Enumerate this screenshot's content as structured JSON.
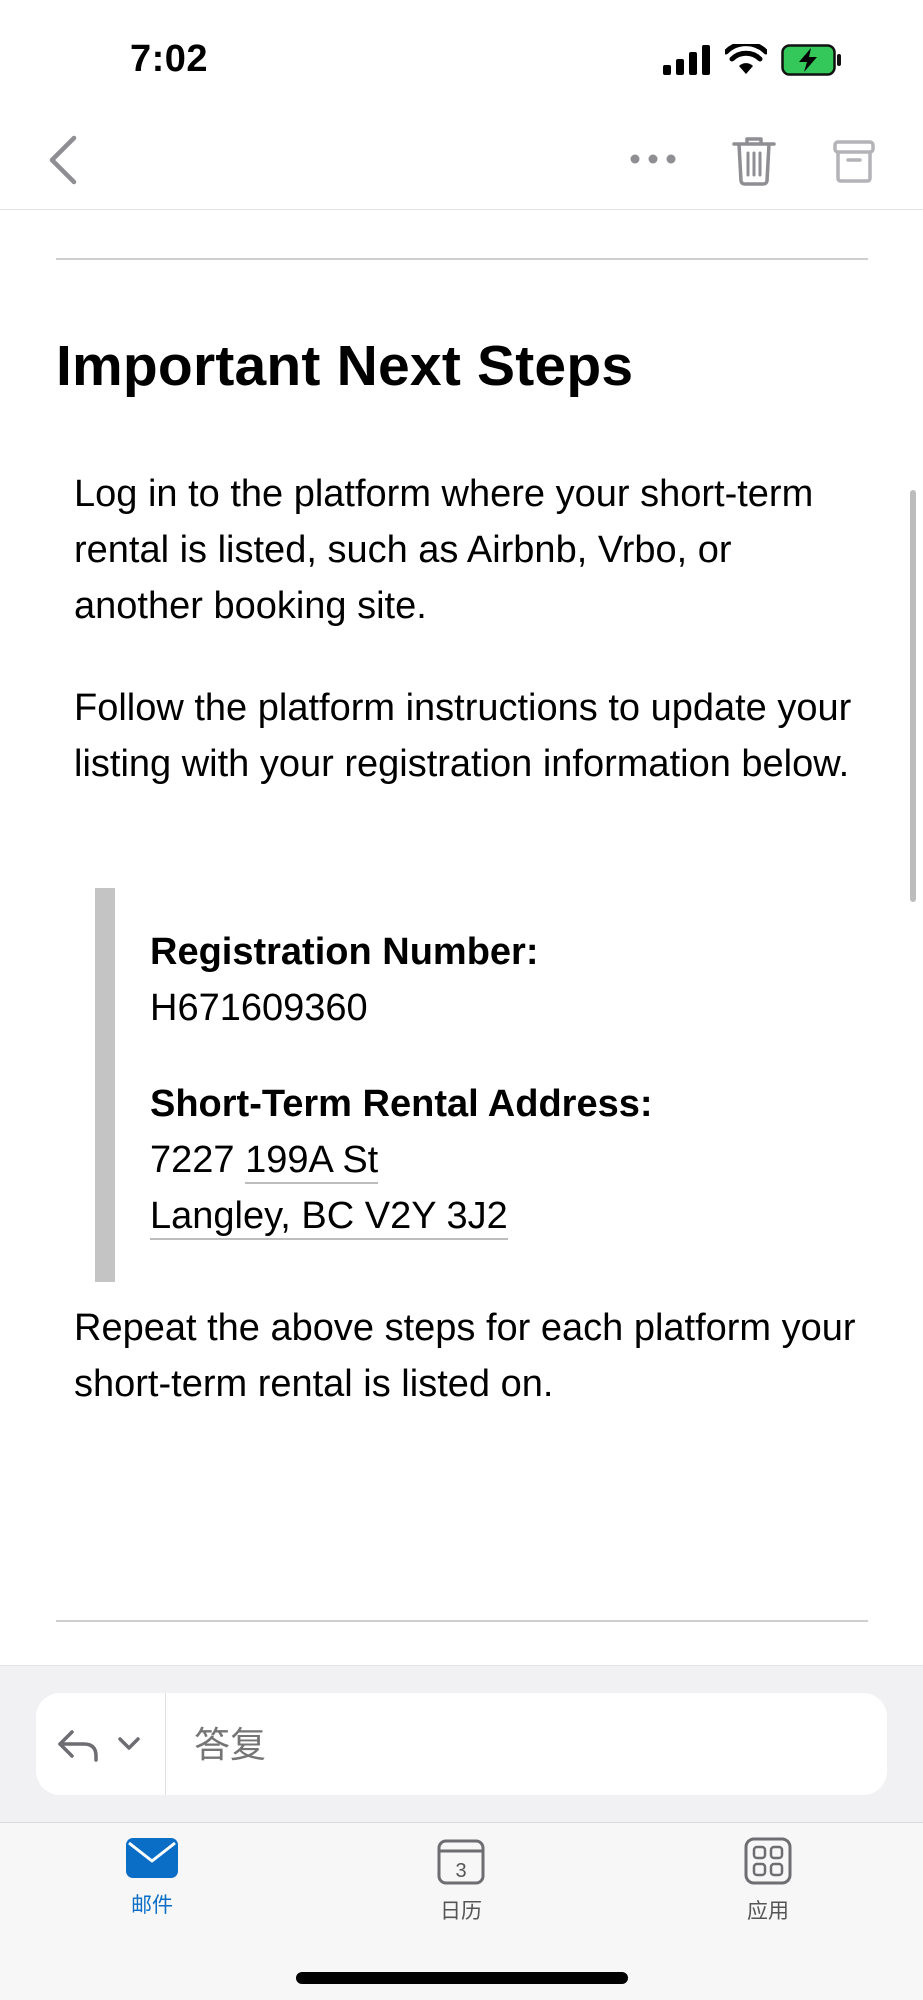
{
  "status_bar": {
    "time": "7:02",
    "icons": [
      "signal-icon",
      "wifi-icon",
      "battery-charging-icon"
    ],
    "battery_color": "#34c759"
  },
  "nav": {
    "icons": [
      "chevron-left-icon",
      "more-icon",
      "trash-icon",
      "archive-icon"
    ]
  },
  "email": {
    "heading": "Important Next Steps",
    "paragraph_1": "Log in to the platform where your short-term rental is listed, such as Airbnb, Vrbo, or another booking site.",
    "paragraph_2": "Follow the platform instructions to update your listing with your registration information below.",
    "registration_label": "Registration Number:",
    "registration_number": "H671609360",
    "address_label": "Short-Term Rental Address:",
    "address_street_number": "7227",
    "address_street_name": "199A St",
    "address_line2": "Langley, BC V2Y 3J2",
    "paragraph_3": "Repeat the above steps for each platform your short-term rental is listed on."
  },
  "reply": {
    "placeholder": "答复"
  },
  "tabs": [
    {
      "label": "邮件",
      "icon": "mail-icon",
      "active": true
    },
    {
      "label": "日历",
      "icon": "calendar-icon",
      "badge": "3",
      "active": false
    },
    {
      "label": "应用",
      "icon": "apps-grid-icon",
      "active": false
    }
  ],
  "colors": {
    "accent": "#0a6ec7",
    "icon_gray": "#8e8e93"
  }
}
